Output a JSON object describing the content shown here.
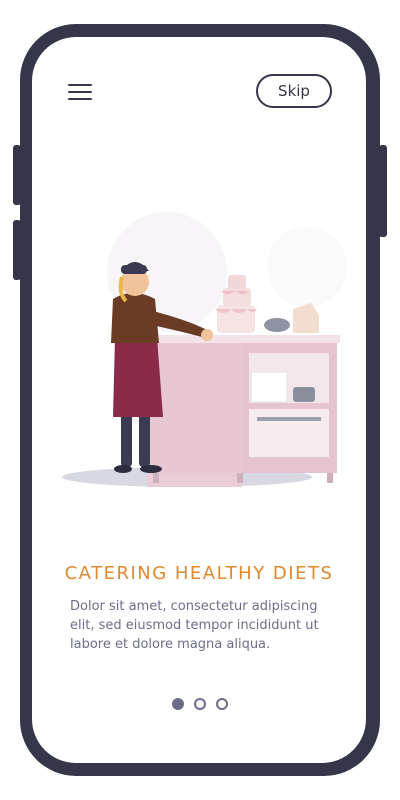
{
  "header": {
    "menu_icon": "hamburger-menu-icon",
    "skip_label": "Skip"
  },
  "onboarding": {
    "illustration": "chef-decorating-cake-illustration",
    "title": "CATERING HEALTHY DIETS",
    "description": "Dolor sit amet, consectetur adipiscing elit, sed eiusmod tempor incididunt ut labore et dolore magna aliqua."
  },
  "pagination": {
    "total": 3,
    "active_index": 0
  },
  "colors": {
    "frame": "#36364a",
    "title": "#e0892f",
    "text": "#6d6d8a"
  }
}
